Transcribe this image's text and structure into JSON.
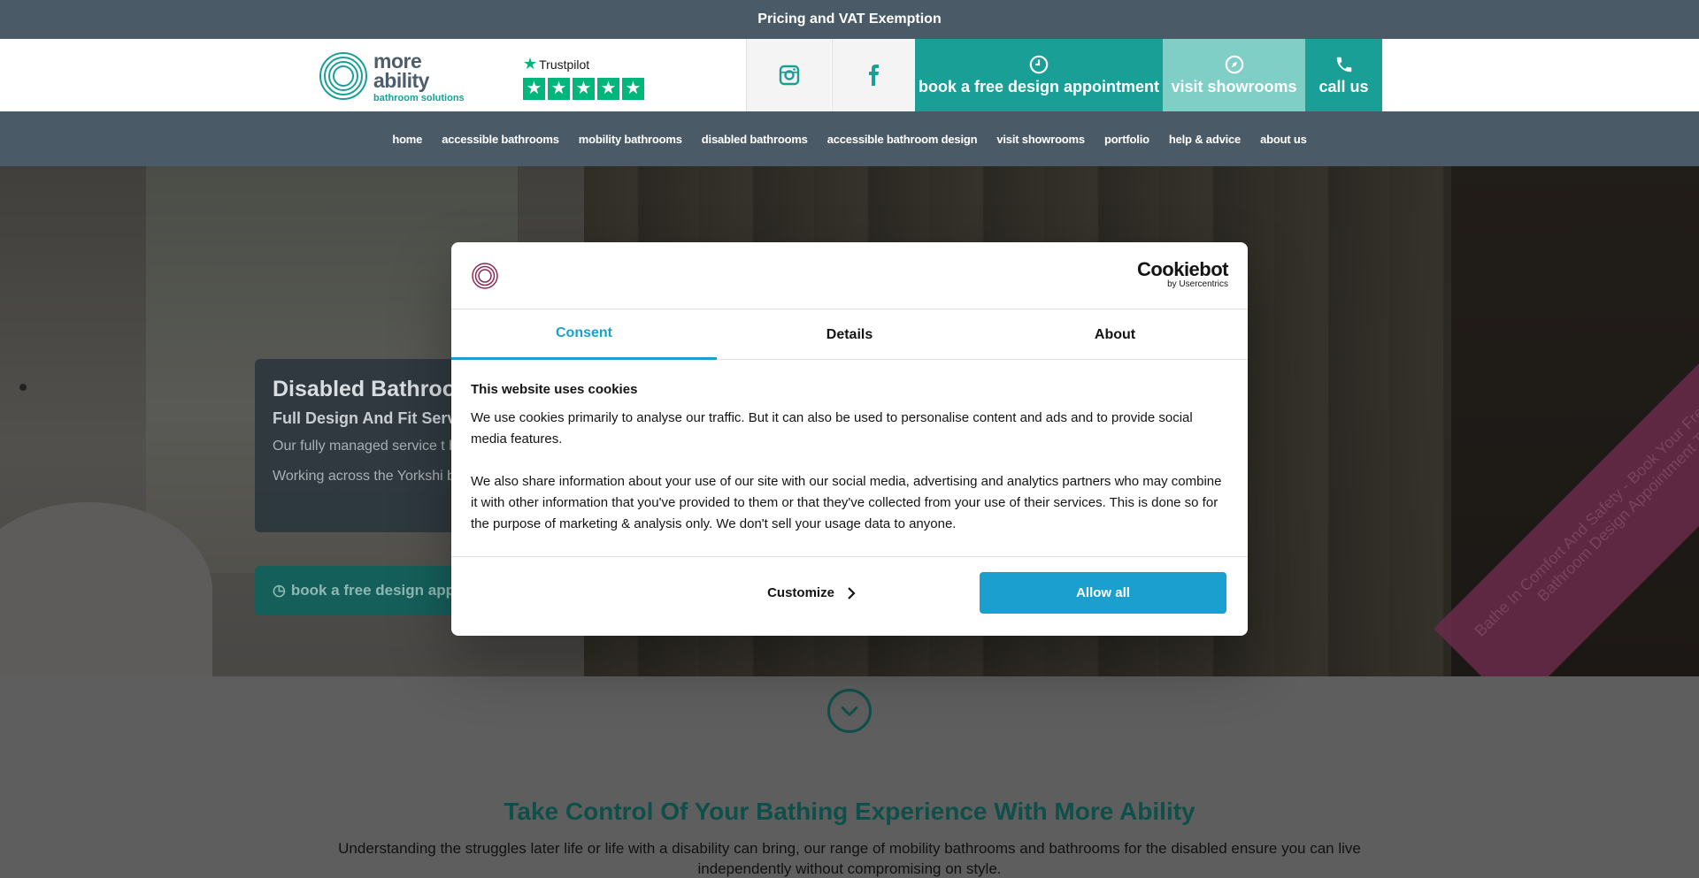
{
  "topbar": {
    "text": "Pricing and VAT Exemption"
  },
  "header": {
    "logo": {
      "line1": "more",
      "line2": "ability",
      "tagline": "bathroom solutions"
    },
    "trustpilot": {
      "label": "Trustpilot",
      "rating_stars": 5
    },
    "social": {
      "instagram_icon": "instagram-icon",
      "facebook_icon": "facebook-icon"
    },
    "cta": {
      "book": "book a free design appointment",
      "showrooms": "visit showrooms",
      "call": "call us"
    }
  },
  "nav": {
    "items": [
      "home",
      "accessible bathrooms",
      "mobility bathrooms",
      "disabled bathrooms",
      "accessible bathroom design",
      "visit showrooms",
      "portfolio",
      "help & advice",
      "about us"
    ]
  },
  "hero": {
    "title": "Disabled Bathroom",
    "subtitle": "Full Design And Fit Servi",
    "para1": "Our fully managed service t bathroom design through t",
    "para2": "Working across the Yorkshi bathing experience. Helpin",
    "button": "book a free design appo",
    "banner": "Bathe In Comfort And Safety - Book Your Free Accessible Bathroom Design Appointment Today!"
  },
  "lower": {
    "heading": "Take Control Of Your Bathing Experience With More Ability",
    "intro": "Understanding the struggles later life or life with a disability can bring, our range of mobility bathrooms and bathrooms for the disabled ensure you can live independently without compromising on style."
  },
  "cookie_modal": {
    "brand": {
      "name": "Cookiebot",
      "by": "by Usercentrics"
    },
    "tabs": [
      "Consent",
      "Details",
      "About"
    ],
    "active_tab": "Consent",
    "heading": "This website uses cookies",
    "paragraph1": "We use cookies primarily to analyse our traffic. But it can also be used to personalise content and ads and to provide social media features.",
    "paragraph2": "We also share information about your use of our site with our social media, advertising and analytics partners who may combine it with other information that you've provided to them or that they've collected from your use of their services. This is done so for the purpose of marketing & analysis only. We don't sell your usage data to anyone.",
    "customize": "Customize",
    "allow_all": "Allow all"
  },
  "colors": {
    "teal": "#1a9f96",
    "teal_light": "#7fcfc7",
    "slate": "#4a5a66",
    "cookie_blue": "#1a9fcf"
  }
}
